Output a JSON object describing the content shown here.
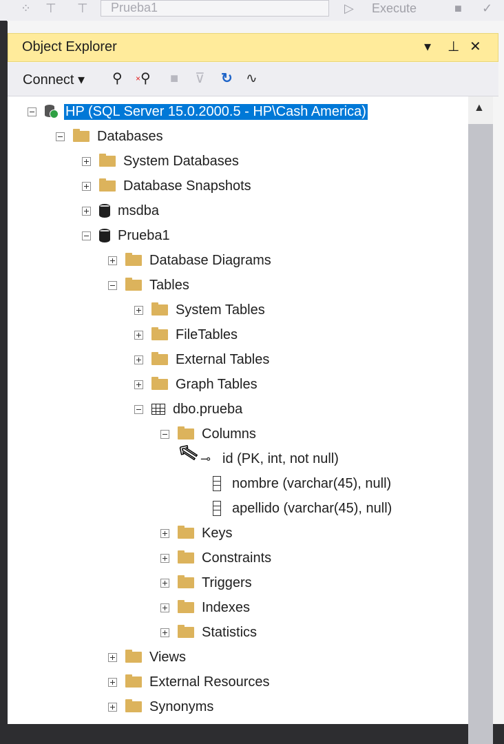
{
  "topbar": {
    "combo_value": "Prueba1",
    "execute_label": "Execute"
  },
  "panel": {
    "title": "Object Explorer",
    "pin_icon": "pin-icon",
    "close_icon": "close-icon",
    "dropdown_icon": "dropdown-icon"
  },
  "toolbar": {
    "connect_label": "Connect",
    "icons": [
      "connect-icon",
      "disconnect-icon",
      "stop-icon",
      "filter-icon",
      "refresh-icon",
      "activity-icon"
    ]
  },
  "tree": {
    "server": "HP (SQL Server 15.0.2000.5 - HP\\Cash America)",
    "databases": "Databases",
    "system_databases": "System Databases",
    "database_snapshots": "Database Snapshots",
    "msdba": "msdba",
    "prueba1": "Prueba1",
    "database_diagrams": "Database Diagrams",
    "tables": "Tables",
    "system_tables": "System Tables",
    "filetables": "FileTables",
    "external_tables": "External Tables",
    "graph_tables": "Graph Tables",
    "dbo_prueba": "dbo.prueba",
    "columns": "Columns",
    "col_id": "id (PK, int, not null)",
    "col_nombre": "nombre (varchar(45), null)",
    "col_apellido": "apellido (varchar(45), null)",
    "keys": "Keys",
    "constraints": "Constraints",
    "triggers": "Triggers",
    "indexes": "Indexes",
    "statistics": "Statistics",
    "views": "Views",
    "external_resources": "External Resources",
    "synonyms": "Synonyms"
  },
  "colors": {
    "title_bg": "#ffeb9b",
    "selection": "#0078d7",
    "folder": "#dcb35c"
  }
}
